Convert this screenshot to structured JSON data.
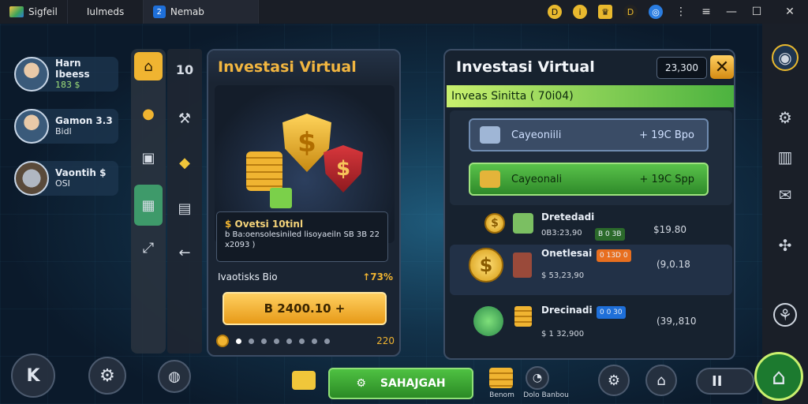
{
  "topbar": {
    "tabs": [
      {
        "label": "Sigfeil"
      },
      {
        "label": "Iulmeds"
      },
      {
        "label": "Nemab"
      }
    ]
  },
  "profiles": [
    {
      "name": "Harn Ibeess",
      "value": "183 $"
    },
    {
      "name": "Gamon 3.3",
      "value": "Bidl"
    },
    {
      "name": "Vaontih $",
      "value": "OSI"
    }
  ],
  "tools": {
    "counter": "10"
  },
  "invest": {
    "title": "Investasi Virtual",
    "info_title": "Ovetsi 10tinl",
    "info_text": "b Ba:oensolesiniled lisoyaeiln SB 3B 22 x2093 )",
    "stat_label": "Ivaotisks Bio",
    "stat_value": "↑73%",
    "buy_label": "B 2400.10 +",
    "coin_amount": "220"
  },
  "right_panel": {
    "title": "Investasi Virtual",
    "badge": "23,300",
    "subtitle": "Inveas Sinitta ( 70i04)",
    "offers": [
      {
        "name": "Cayeoniili",
        "price": "+ 19C Bpo"
      },
      {
        "name": "Cayeonali",
        "price": "+ 19C Spp"
      }
    ],
    "rows": [
      {
        "name": "Dretedadi",
        "sub": "0B3:23,90",
        "pill": "B 0 3B",
        "amount": "$19.80"
      },
      {
        "name": "Onetlesai",
        "sub": "$ 53,23,90",
        "pill": "0 13D 0",
        "amount": "(9,0.18"
      },
      {
        "name": "Drecinadi",
        "sub": "$ 1 32,900",
        "pill": "0 0 30",
        "amount": "(39,,810"
      }
    ]
  },
  "bottom": {
    "save_label": "SAHAJGAH",
    "label_1": "Benom",
    "label_2": "Dolo Banbou"
  }
}
